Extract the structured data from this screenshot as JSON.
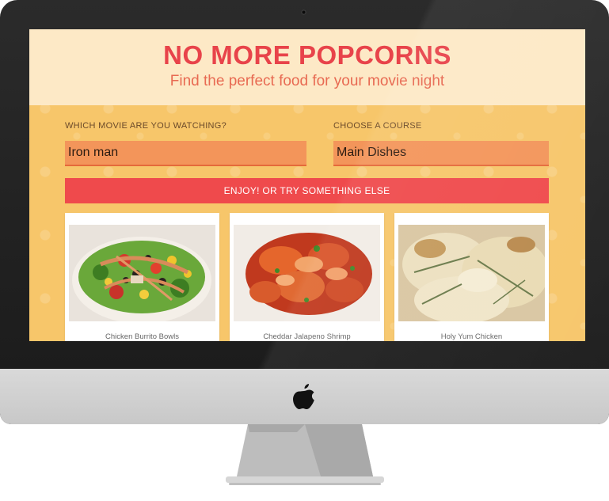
{
  "hero": {
    "title": "NO MORE POPCORNS",
    "subtitle": "Find the perfect food for your movie night"
  },
  "form": {
    "movie": {
      "label": "WHICH MOVIE ARE YOU WATCHING?",
      "value": "Iron man"
    },
    "course": {
      "label": "CHOOSE A COURSE",
      "value": "Main Dishes"
    },
    "submit_label": "ENJOY! OR TRY SOMETHING ELSE"
  },
  "results": [
    {
      "name": "Chicken Burrito Bowls"
    },
    {
      "name": "Cheddar Jalapeno Shrimp"
    },
    {
      "name": "Holy Yum Chicken"
    }
  ],
  "colors": {
    "accent_red": "#e8434a",
    "button_red": "#ef4a4c",
    "input_orange": "#f3955a",
    "page_yellow": "#f7c66a",
    "hero_cream": "#fde9c6"
  },
  "icons": {
    "apple_logo": "apple-logo-icon",
    "camera": "camera-dot"
  }
}
